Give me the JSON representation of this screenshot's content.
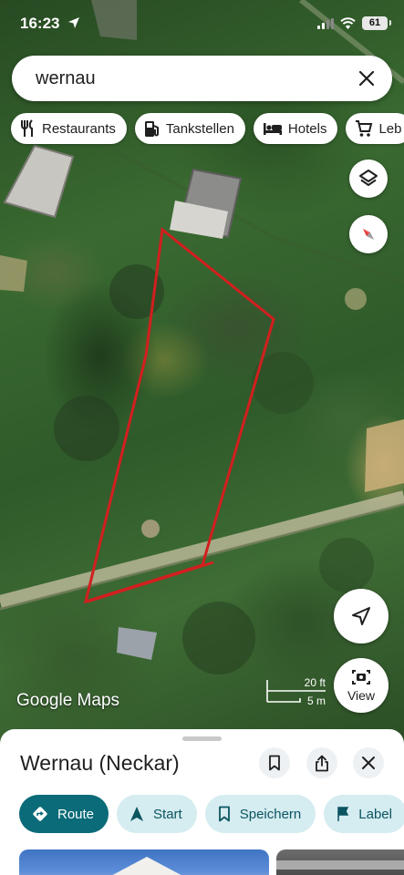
{
  "status_bar": {
    "time": "16:23",
    "battery": "61"
  },
  "search": {
    "query": "wernau"
  },
  "chips": [
    {
      "label": "Restaurants",
      "icon": "cutlery-icon"
    },
    {
      "label": "Tankstellen",
      "icon": "gas-station-icon"
    },
    {
      "label": "Hotels",
      "icon": "bed-icon"
    },
    {
      "label": "Leb",
      "icon": "cart-icon"
    }
  ],
  "map": {
    "attribution": "Google Maps",
    "scale": {
      "feet": "20 ft",
      "meters": "5 m"
    },
    "view_button_label": "View",
    "parcel_outline_color": "#d21f1f"
  },
  "place": {
    "title": "Wernau (Neckar)",
    "actions": [
      {
        "label": "Route",
        "icon": "directions-icon"
      },
      {
        "label": "Start",
        "icon": "navigation-arrow-icon"
      },
      {
        "label": "Speichern",
        "icon": "bookmark-icon"
      },
      {
        "label": "Label",
        "icon": "flag-icon"
      }
    ]
  },
  "colors": {
    "accent": "#0b6b78",
    "accent_light": "#d5ecf0"
  }
}
